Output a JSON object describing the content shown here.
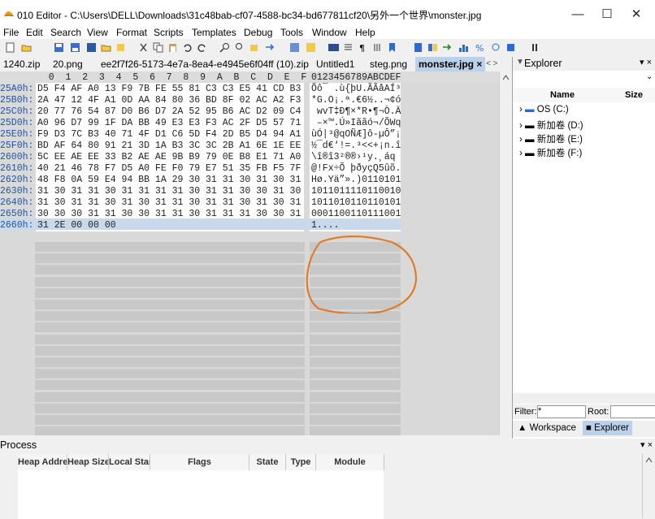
{
  "window": {
    "title": "010 Editor - C:\\Users\\DELL\\Downloads\\31c48bab-cf07-4588-bc34-bd677811cf20\\另外一个世界\\monster.jpg"
  },
  "menu": [
    "File",
    "Edit",
    "Search",
    "View",
    "Format",
    "Scripts",
    "Templates",
    "Debug",
    "Tools",
    "Window",
    "Help"
  ],
  "tabs": [
    "1240.zip",
    "20.png",
    "ee2f7f26-5173-4e7a-8ea4-e4945e6f04ff (10).zip",
    "Untitled1",
    "steg.png",
    "monster.jpg"
  ],
  "active_tab_close": "×",
  "editor": {
    "hex_header": "  0  1  2  3  4  5  6  7  8  9  A  B  C  D  E  F",
    "ascii_header": "0123456789ABCDEF",
    "rows": [
      {
        "addr": "25A0h:",
        "hex": "D5 F4 AF A0 13 F9 7B FE 55 81 C3 C3 E5 41 CD B3",
        "ascii": "Õô¯ .ù{þU.ÃÃåAÍ³"
      },
      {
        "addr": "25B0h:",
        "hex": "2A 47 12 4F A1 0D AA 84 80 36 BD 8F 02 AC A2 F3",
        "ascii": "*G.O¡.ª.€6½..¬¢ó"
      },
      {
        "addr": "25C0h:",
        "hex": "20 77 76 54 87 D0 B6 D7 2A 52 95 B6 AC D2 09 C4",
        "ascii": " wvT‡Ð¶×*R•¶¬Ò.Ä"
      },
      {
        "addr": "25D0h:",
        "hex": "A0 96 D7 99 1F DA BB 49 E3 E3 F3 AC 2F D5 57 71",
        "ascii": " –×™.Ú»Iããó¬/ÕWq"
      },
      {
        "addr": "25E0h:",
        "hex": "F9 D3 7C B3 40 71 4F D1 C6 5D F4 2D B5 D4 94 A1",
        "ascii": "ùÓ|³@qOÑÆ]ô-µÔ”¡"
      },
      {
        "addr": "25F0h:",
        "hex": "BD AF 64 80 91 21 3D 1A B3 3C 3C 2B A1 6E 1E EE",
        "ascii": "½¯d€‘!=.³<<+¡n.î"
      },
      {
        "addr": "2600h:",
        "hex": "5C EE AE EE 33 B2 AE AE 9B B9 79 0E B8 E1 71 A0",
        "ascii": "\\î®î3²®®›¹y.¸áq "
      },
      {
        "addr": "2610h:",
        "hex": "40 21 46 78 F7 D5 A0 FE F0 79 E7 51 35 FB F5 7F",
        "ascii": "@!Fx÷Õ þðyçQ5ûõ."
      },
      {
        "addr": "2620h:",
        "hex": "48 F8 0A 59 E4 94 BB 1A 29 30 31 31 30 31 30 31",
        "ascii": "Hø.Yä”».)0110101"
      },
      {
        "addr": "2630h:",
        "hex": "31 30 31 31 30 31 31 31 31 30 31 31 30 30 31 30",
        "ascii": "1011011110110010"
      },
      {
        "addr": "2640h:",
        "hex": "31 30 31 31 30 31 30 31 31 30 31 31 30 31 30 31",
        "ascii": "1011010110110101"
      },
      {
        "addr": "2650h:",
        "hex": "30 30 30 31 31 30 30 31 31 30 31 31 31 30 30 31",
        "ascii": "0001100110111001"
      },
      {
        "addr": "2660h:",
        "hex": "31 2E 00 00 00",
        "ascii": "1...."
      }
    ]
  },
  "explorer": {
    "title": "Explorer",
    "columns": [
      "Name",
      "Size"
    ],
    "items": [
      "OS (C:)",
      "新加卷 (D:)",
      "新加卷 (E:)",
      "新加卷 (F:)"
    ],
    "filter_label": "Filter:",
    "filter_value": "*",
    "root_label": "Root:",
    "tabs": [
      "Workspace",
      "Explorer"
    ]
  },
  "process": {
    "title": "Process",
    "columns": [
      "Heap Address",
      "Heap Size",
      "Local Start",
      "Flags",
      "State",
      "Type",
      "Module"
    ]
  },
  "colors": {
    "accent_tab": "#b9d1ea",
    "address": "#1f55a6",
    "annotation": "#e07b2a",
    "selection": "#c9d8ea"
  }
}
